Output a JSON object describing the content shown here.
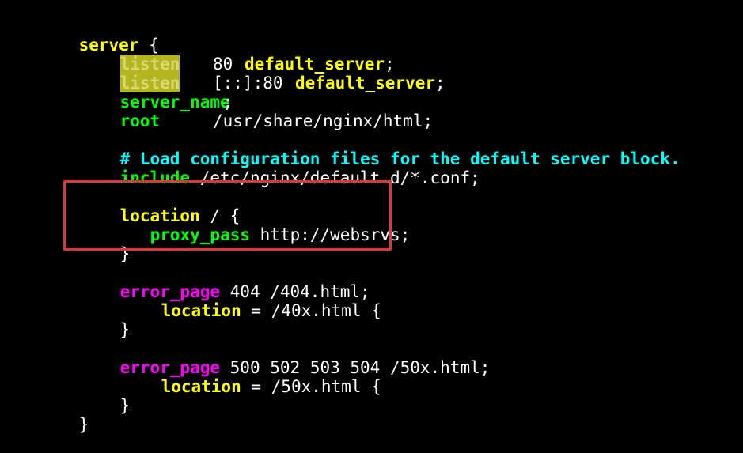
{
  "colors": {
    "background": "#000000",
    "plain_text": "#ffffff",
    "keyword_yellow": "#ffff00",
    "keyword_green": "#00ff00",
    "keyword_magenta": "#ff00ff",
    "comment": "#00ffff",
    "search_highlight": "#b5b520",
    "annotation_box": "#e0353a"
  },
  "code": {
    "l1_server": "server",
    "l1_brace": " {",
    "l2_listen": "listen",
    "l2_value": "80",
    "l2_default": "default_server",
    "l2_semi": ";",
    "l3_listen": "listen",
    "l3_value": "[::]:80",
    "l3_default": "default_server",
    "l3_semi": ";",
    "l4_server_name": "server_name",
    "l4_value": "_;",
    "l5_root": "root",
    "l5_value": "/usr/share/nginx/html;",
    "l7_comment": "# Load configuration files for the default server block.",
    "l8_include": "include",
    "l8_value": " /etc/nginx/default.d/*.conf;",
    "l10_location": "location",
    "l10_value": " / {",
    "l11_proxy_pass": "proxy_pass",
    "l11_value": " http://websrvs;",
    "l12_brace": "}",
    "l14_error_page": "error_page",
    "l14_value": " 404 /404.html;",
    "l15_location": "location",
    "l15_value": " = /40x.html {",
    "l16_brace": "}",
    "l18_error_page": "error_page",
    "l18_value": " 500 502 503 504 /50x.html;",
    "l19_location": "location",
    "l19_value": " = /50x.html {",
    "l20_brace": "}",
    "l21_brace": "}"
  }
}
